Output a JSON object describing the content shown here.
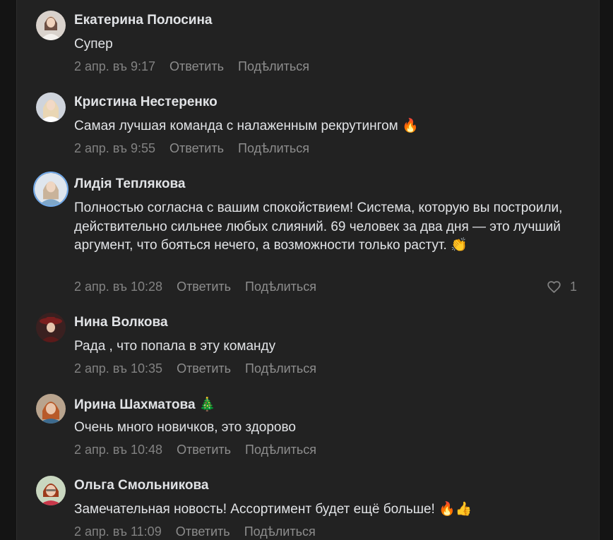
{
  "comments": [
    {
      "author": "Екатерина Полосина",
      "text": "Супер",
      "time": "2 апр. въ 9:17",
      "reply": "Ответить",
      "share": "Подѣлиться"
    },
    {
      "author": "Кристина Нестеренко",
      "text": "Самая лучшая команда с налаженным рекрутингом 🔥",
      "time": "2 апр. въ 9:55",
      "reply": "Ответить",
      "share": "Подѣлиться"
    },
    {
      "author": "Лидія Теплякова",
      "text": "Полностью согласна с вашим спокойствием! Система, которую вы построили, действительно сильнее любых слияний. 69 человек за два дня — это лучший аргумент, что бояться нечего, а возможности только растут. 👏",
      "time": "2 апр. въ 10:28",
      "reply": "Ответить",
      "share": "Подѣлиться",
      "likes": "1"
    },
    {
      "author": "Нина Волкова",
      "text": "Рада , что попала в эту команду",
      "time": "2 апр. въ 10:35",
      "reply": "Ответить",
      "share": "Подѣлиться"
    },
    {
      "author": "Ирина Шахматова 🎄",
      "text": "Очень много новичков, это здорово",
      "time": "2 апр. въ 10:48",
      "reply": "Ответить",
      "share": "Подѣлиться"
    },
    {
      "author": "Ольга Смольникова",
      "text": "Замечательная новость! Ассортимент будет ещё больше! 🔥👍",
      "time": "2 апр. въ 11:09",
      "reply": "Ответить",
      "share": "Подѣлиться"
    }
  ],
  "icons": {
    "like": "heart-icon"
  },
  "colors": {
    "background": "#222222",
    "text": "#e1e3e6",
    "secondary": "#828282",
    "avatar_ring": "#71aaeb"
  }
}
